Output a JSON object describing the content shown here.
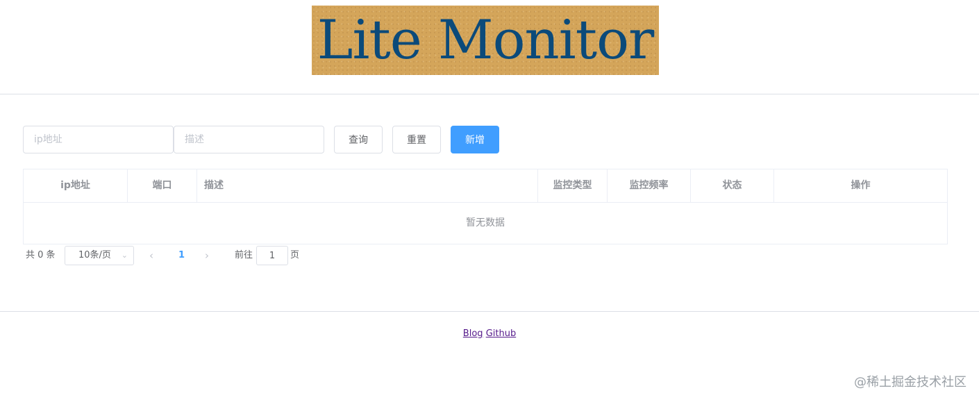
{
  "header": {
    "logo_text": "Lite Monitor"
  },
  "search": {
    "ip_placeholder": "ip地址",
    "desc_placeholder": "描述",
    "query_label": "查询",
    "reset_label": "重置",
    "add_label": "新增",
    "accent_color": "#409eff"
  },
  "table": {
    "columns": [
      "ip地址",
      "端口",
      "描述",
      "监控类型",
      "监控频率",
      "状态",
      "操作"
    ],
    "empty_text": "暂无数据"
  },
  "pagination": {
    "total_text": "共 0 条",
    "page_size": "10条/页",
    "current_page": "1",
    "goto_label": "前往",
    "goto_value": "1",
    "page_unit": "页"
  },
  "footer": {
    "links": [
      "Blog",
      "Github"
    ]
  },
  "watermark": "@稀土掘金技术社区"
}
